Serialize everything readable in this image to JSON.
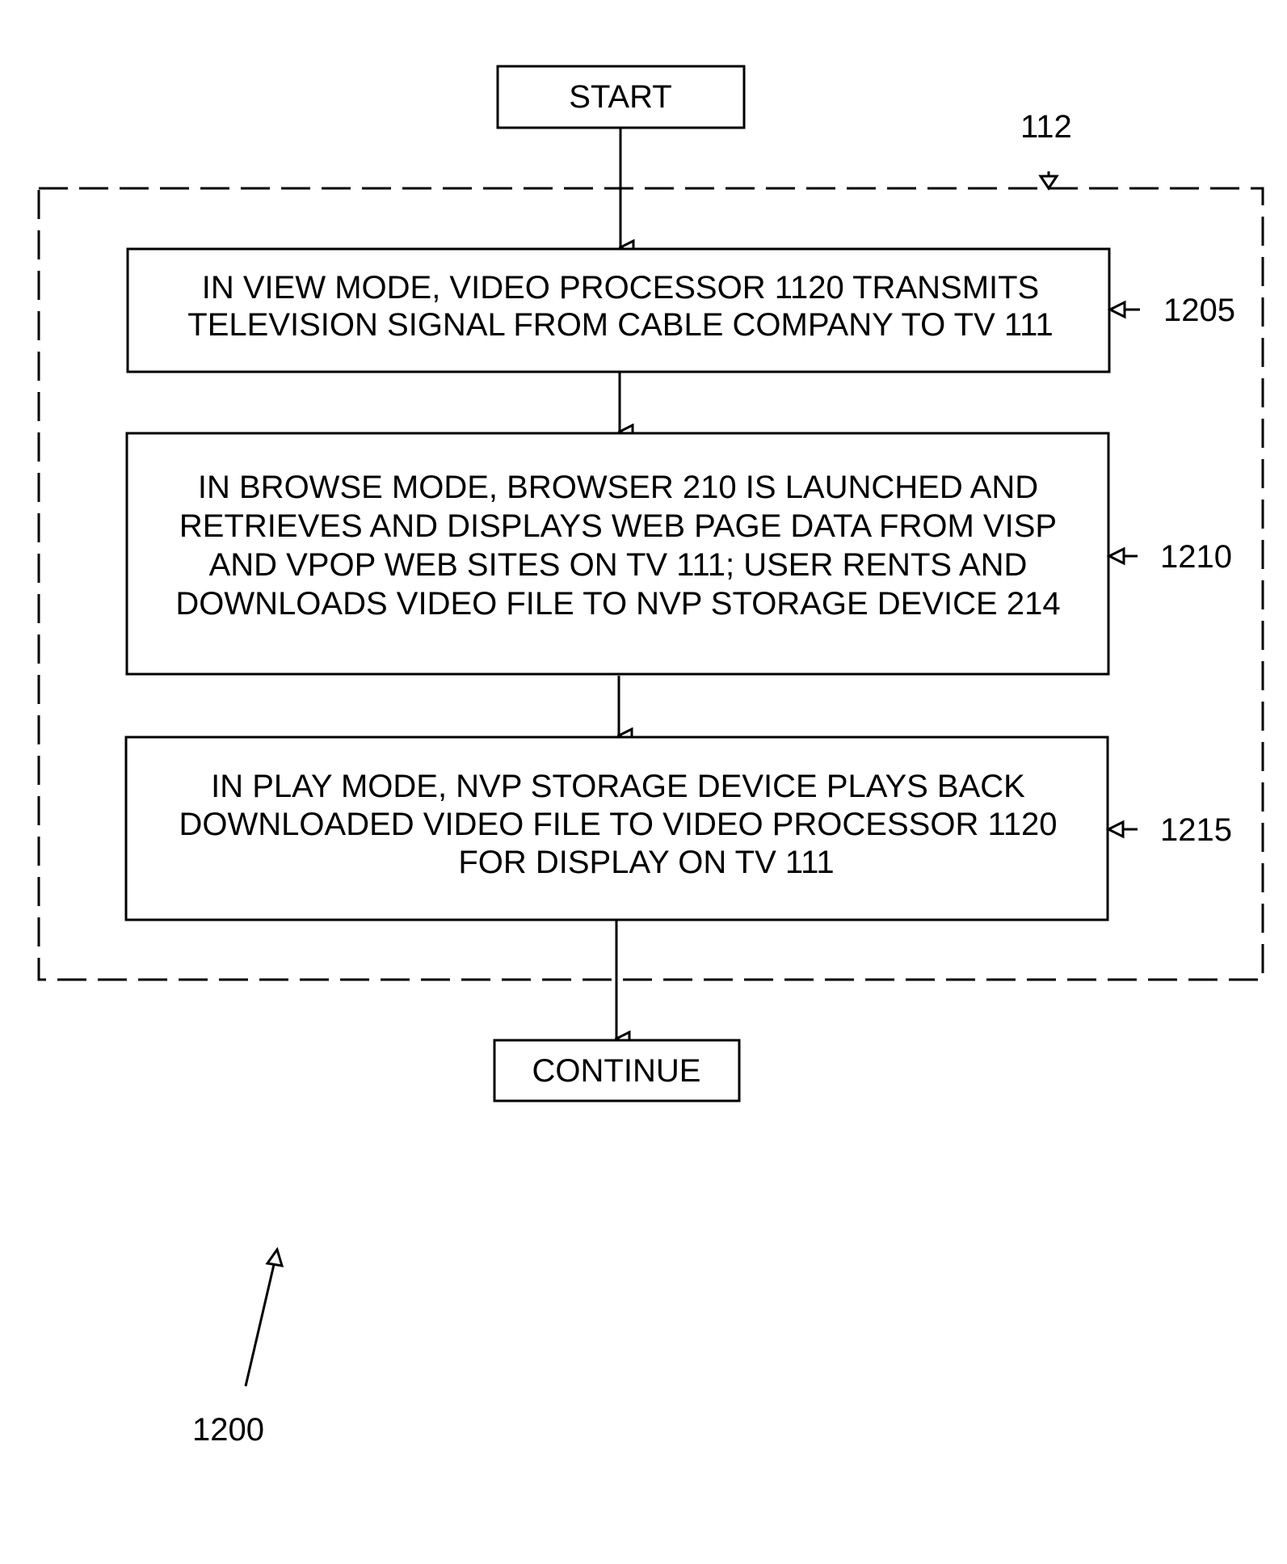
{
  "figure": {
    "reference_numeral": "1200",
    "group_label": "112"
  },
  "start": {
    "label": "START"
  },
  "continue": {
    "label": "CONTINUE"
  },
  "steps": [
    {
      "id": "1205",
      "lines": [
        "IN VIEW MODE, VIDEO PROCESSOR 1120 TRANSMITS",
        "TELEVISION SIGNAL FROM CABLE COMPANY TO TV 111"
      ]
    },
    {
      "id": "1210",
      "lines": [
        "IN BROWSE MODE, BROWSER 210 IS LAUNCHED AND",
        "RETRIEVES AND DISPLAYS WEB PAGE DATA FROM VISP",
        "AND VPOP WEB SITES ON TV 111;  USER RENTS AND",
        "DOWNLOADS VIDEO FILE TO NVP STORAGE DEVICE 214"
      ]
    },
    {
      "id": "1215",
      "lines": [
        "IN PLAY MODE, NVP STORAGE DEVICE PLAYS BACK",
        "DOWNLOADED VIDEO FILE TO VIDEO PROCESSOR 1120",
        "FOR DISPLAY ON TV 111"
      ]
    }
  ]
}
